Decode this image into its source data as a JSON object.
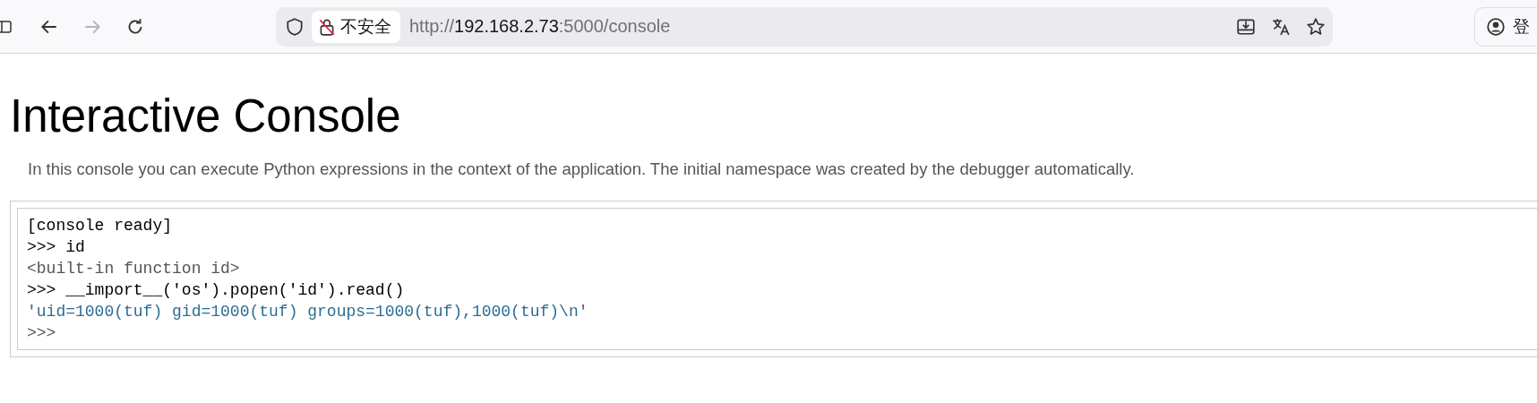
{
  "browser": {
    "security_label": "不安全",
    "url_scheme": "http://",
    "url_host": "192.168.2.73",
    "url_rest": ":5000/console",
    "forward_disabled": true,
    "profile_label": "登"
  },
  "page": {
    "title": "Interactive Console",
    "intro": "In this console you can execute Python expressions in the context of the application. The initial namespace was created by the debugger automatically."
  },
  "console": {
    "lines": [
      {
        "kind": "input",
        "text": "[console ready]"
      },
      {
        "kind": "input",
        "text": ">>> id"
      },
      {
        "kind": "result",
        "text": "<built-in function id>"
      },
      {
        "kind": "input",
        "text": ">>> __import__('os').popen('id').read()"
      },
      {
        "kind": "string",
        "text": "'uid=1000(tuf) gid=1000(tuf) groups=1000(tuf),1000(tuf)\\n'"
      },
      {
        "kind": "result",
        "text": ">>>"
      }
    ]
  }
}
